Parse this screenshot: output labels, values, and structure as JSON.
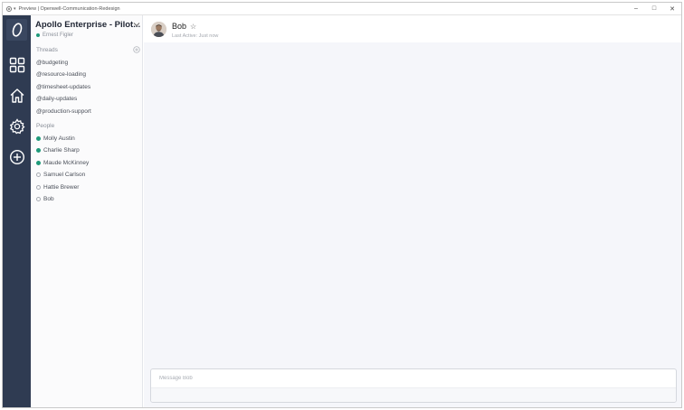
{
  "window": {
    "title": "Preview | Openwell-Communication-Redesign",
    "minimize": "–",
    "maximize": "□",
    "close": "✕"
  },
  "rail": {
    "icons": [
      "logo-icon",
      "grid-icon",
      "home-icon",
      "gear-icon",
      "plus-circle-icon"
    ]
  },
  "sidebar": {
    "workspace_name": "Apollo Enterprise - Pilot...",
    "current_user": "Ernest Figler",
    "threads_label": "Threads",
    "threads": [
      {
        "label": "@budgeting"
      },
      {
        "label": "@resource-loading"
      },
      {
        "label": "@timesheet-updates"
      },
      {
        "label": "@daily-updates"
      },
      {
        "label": "@production-support"
      }
    ],
    "people_label": "People",
    "people": [
      {
        "label": "Molly Austin",
        "status": "online"
      },
      {
        "label": "Charlie Sharp",
        "status": "online"
      },
      {
        "label": "Maude McKinney",
        "status": "online"
      },
      {
        "label": "Samuel Carlson",
        "status": "offline"
      },
      {
        "label": "Hattie Brewer",
        "status": "offline"
      },
      {
        "label": "Bob",
        "status": "offline"
      }
    ]
  },
  "chat": {
    "name": "Bob",
    "star": "☆",
    "last_active": "Last Active: Just now",
    "composer_placeholder": "Message Bob"
  },
  "colors": {
    "rail": "#2f3b52",
    "online": "#1f9a7a",
    "main_bg": "#f5f6fa"
  }
}
